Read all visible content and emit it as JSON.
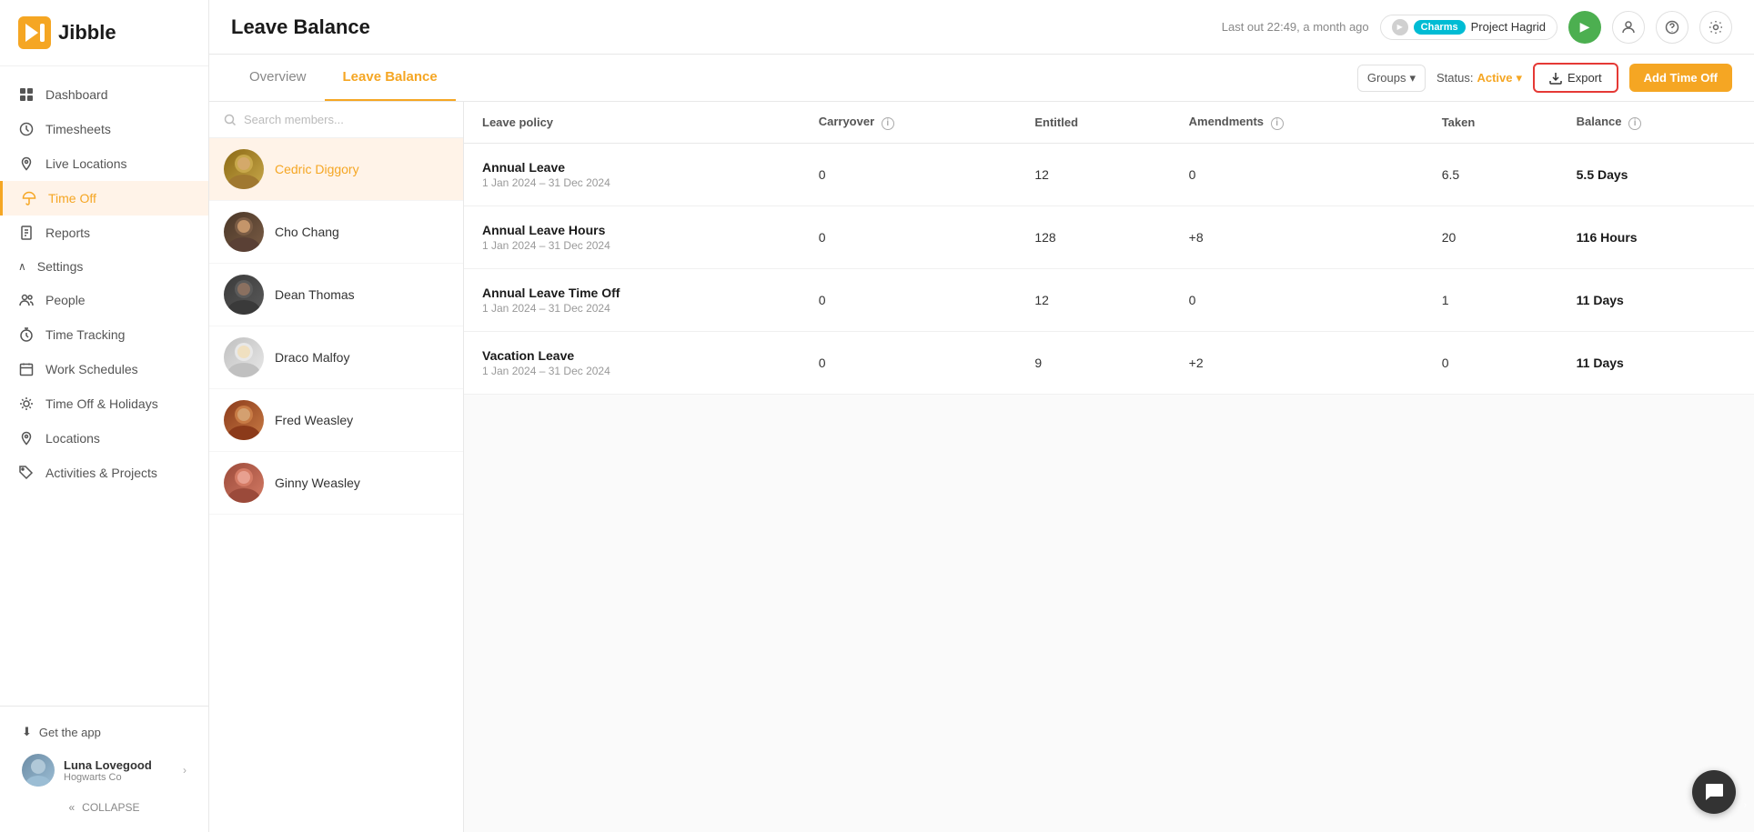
{
  "app": {
    "name": "Jibble"
  },
  "header": {
    "title": "Leave Balance",
    "last_out": "Last out 22:49, a month ago",
    "project_tag": "Charms",
    "project_name": "Project Hagrid"
  },
  "sidebar": {
    "nav_items": [
      {
        "id": "dashboard",
        "label": "Dashboard",
        "icon": "grid"
      },
      {
        "id": "timesheets",
        "label": "Timesheets",
        "icon": "clock"
      },
      {
        "id": "live-locations",
        "label": "Live Locations",
        "icon": "map-pin"
      },
      {
        "id": "time-off",
        "label": "Time Off",
        "icon": "umbrella",
        "active": true
      },
      {
        "id": "reports",
        "label": "Reports",
        "icon": "file"
      }
    ],
    "settings_section": "Settings",
    "settings_items": [
      {
        "id": "people",
        "label": "People",
        "icon": "users"
      },
      {
        "id": "time-tracking",
        "label": "Time Tracking",
        "icon": "timer"
      },
      {
        "id": "work-schedules",
        "label": "Work Schedules",
        "icon": "calendar"
      },
      {
        "id": "time-off-holidays",
        "label": "Time Off & Holidays",
        "icon": "sun"
      },
      {
        "id": "locations",
        "label": "Locations",
        "icon": "location"
      },
      {
        "id": "activities-projects",
        "label": "Activities & Projects",
        "icon": "tag"
      }
    ],
    "get_app": "Get the app",
    "user": {
      "name": "Luna Lovegood",
      "company": "Hogwarts Co"
    },
    "collapse": "COLLAPSE"
  },
  "tabs": [
    {
      "id": "overview",
      "label": "Overview",
      "active": false
    },
    {
      "id": "leave-balance",
      "label": "Leave Balance",
      "active": true
    }
  ],
  "filters": {
    "groups_label": "Groups",
    "status_label": "Status: ",
    "status_value": "Active",
    "export_label": "Export",
    "add_time_off_label": "Add Time Off"
  },
  "search": {
    "placeholder": "Search members..."
  },
  "members": [
    {
      "id": "cedric",
      "name": "Cedric Diggory",
      "selected": true,
      "avatar_class": "avatar-cedric"
    },
    {
      "id": "cho",
      "name": "Cho Chang",
      "selected": false,
      "avatar_class": "avatar-cho"
    },
    {
      "id": "dean",
      "name": "Dean Thomas",
      "selected": false,
      "avatar_class": "avatar-dean"
    },
    {
      "id": "draco",
      "name": "Draco Malfoy",
      "selected": false,
      "avatar_class": "avatar-draco"
    },
    {
      "id": "fred",
      "name": "Fred Weasley",
      "selected": false,
      "avatar_class": "avatar-fred"
    },
    {
      "id": "ginny",
      "name": "Ginny Weasley",
      "selected": false,
      "avatar_class": "avatar-ginny"
    }
  ],
  "table": {
    "columns": [
      {
        "id": "leave_policy",
        "label": "Leave policy"
      },
      {
        "id": "carryover",
        "label": "Carryover"
      },
      {
        "id": "entitled",
        "label": "Entitled"
      },
      {
        "id": "amendments",
        "label": "Amendments"
      },
      {
        "id": "taken",
        "label": "Taken"
      },
      {
        "id": "balance",
        "label": "Balance"
      }
    ],
    "rows": [
      {
        "policy_name": "Annual Leave",
        "policy_date": "1 Jan 2024 – 31 Dec 2024",
        "carryover": "0",
        "entitled": "12",
        "amendments": "0",
        "taken": "6.5",
        "balance": "5.5 Days"
      },
      {
        "policy_name": "Annual Leave Hours",
        "policy_date": "1 Jan 2024 – 31 Dec 2024",
        "carryover": "0",
        "entitled": "128",
        "amendments": "+8",
        "taken": "20",
        "balance": "116 Hours"
      },
      {
        "policy_name": "Annual Leave Time Off",
        "policy_date": "1 Jan 2024 – 31 Dec 2024",
        "carryover": "0",
        "entitled": "12",
        "amendments": "0",
        "taken": "1",
        "balance": "11 Days"
      },
      {
        "policy_name": "Vacation Leave",
        "policy_date": "1 Jan 2024 – 31 Dec 2024",
        "carryover": "0",
        "entitled": "9",
        "amendments": "+2",
        "taken": "0",
        "balance": "11 Days"
      }
    ]
  },
  "colors": {
    "accent": "#f5a623",
    "active_border": "#e53935",
    "green": "#4caf50",
    "cyan": "#00bcd4"
  }
}
